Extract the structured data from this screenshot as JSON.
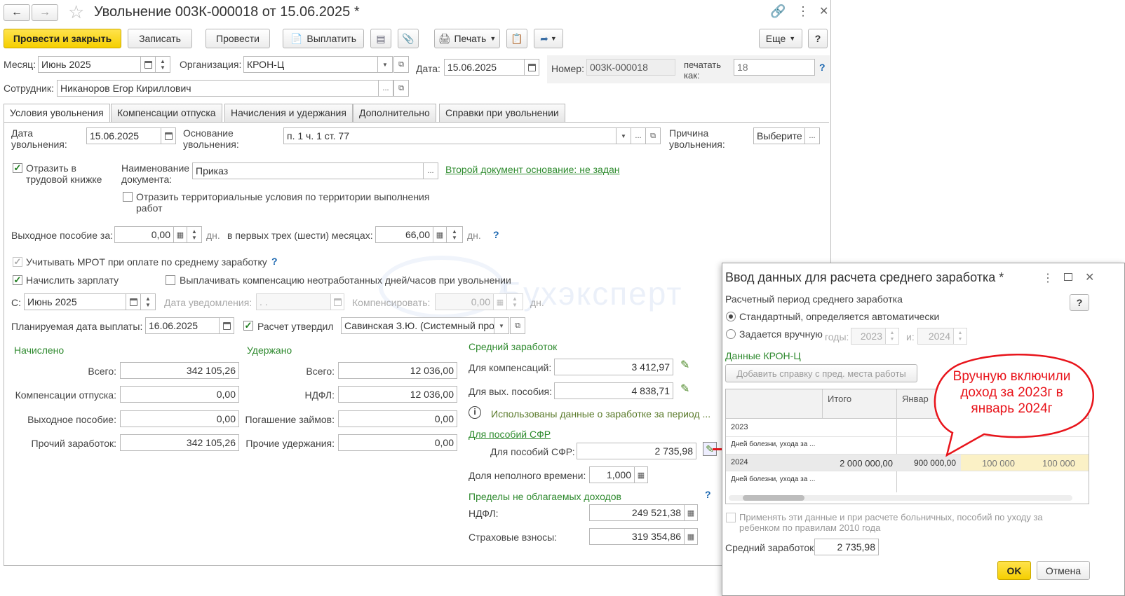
{
  "window": {
    "title": "Увольнение 003К-000018 от 15.06.2025 *"
  },
  "toolbar": {
    "post_close": "Провести и закрыть",
    "save": "Записать",
    "post": "Провести",
    "pay": "Выплатить",
    "print": "Печать",
    "more": "Еще",
    "help": "?"
  },
  "header": {
    "month_label": "Месяц:",
    "month_value": "Июнь 2025",
    "org_label": "Организация:",
    "org_value": "КРОН-Ц",
    "date_label": "Дата:",
    "date_value": "15.06.2025",
    "number_label": "Номер:",
    "number_value": "003К-000018",
    "print_as_label": "печатать как:",
    "print_as_placeholder": "18",
    "employee_label": "Сотрудник:",
    "employee_value": "Никаноров Егор Кириллович"
  },
  "tabs": [
    "Условия увольнения",
    "Компенсации отпуска",
    "Начисления и удержания",
    "Дополнительно",
    "Справки при увольнении"
  ],
  "conditions": {
    "dismissal_date_label": "Дата увольнения:",
    "dismissal_date": "15.06.2025",
    "basis_label": "Основание увольнения:",
    "basis_value": "п. 1 ч. 1 ст. 77",
    "reason_label": "Причина увольнения:",
    "reason_value": "Выберите",
    "reflect_book": "Отразить в трудовой книжке",
    "doc_name_label": "Наименование документа:",
    "doc_name_value": "Приказ",
    "second_doc_link": "Второй документ основание: не задан",
    "territorial": "Отразить территориальные условия по территории выполнения работ",
    "severance_label": "Выходное пособие за:",
    "severance_value": "0,00",
    "days": "дн.",
    "first_months_label": "в первых трех (шести) месяцах:",
    "first_months_value": "66,00",
    "mrot": "Учитывать МРОТ при оплате по среднему заработку",
    "accrue_salary": "Начислить зарплату",
    "pay_comp_unworked": "Выплачивать компенсацию неотработанных дней/часов при увольнении",
    "from_label": "С:",
    "from_value": "Июнь 2025",
    "notice_date_label": "Дата уведомления:",
    "notice_date_value": " .  .",
    "compensate_label": "Компенсировать:",
    "compensate_value": "0,00",
    "planned_pay_label": "Планируемая дата выплаты:",
    "planned_pay_value": "16.06.2025",
    "approved_label": "Расчет утвердил",
    "approved_value": "Савинская З.Ю. (Системный про"
  },
  "accrued": {
    "title": "Начислено",
    "rows": [
      {
        "label": "Всего:",
        "value": "342 105,26"
      },
      {
        "label": "Компенсации отпуска:",
        "value": "0,00"
      },
      {
        "label": "Выходное пособие:",
        "value": "0,00"
      },
      {
        "label": "Прочий заработок:",
        "value": "342 105,26"
      }
    ]
  },
  "withheld": {
    "title": "Удержано",
    "rows": [
      {
        "label": "Всего:",
        "value": "12 036,00"
      },
      {
        "label": "НДФЛ:",
        "value": "12 036,00"
      },
      {
        "label": "Погашение займов:",
        "value": "0,00"
      },
      {
        "label": "Прочие удержания:",
        "value": "0,00"
      }
    ]
  },
  "average": {
    "title": "Средний заработок",
    "comp_label": "Для компенсаций:",
    "comp_value": "3 412,97",
    "sev_label": "Для вых. пособия:",
    "sev_value": "4 838,71",
    "info_text": "Использованы данные о заработке за период ...",
    "sfr_link": "Для пособий СФР",
    "sfr_label": "Для пособий СФР:",
    "sfr_value": "2 735,98",
    "part_time_label": "Доля неполного времени:",
    "part_time_value": "1,000",
    "limits_title": "Пределы не облагаемых доходов",
    "ndfl_label": "НДФЛ:",
    "ndfl_value": "249 521,38",
    "ins_label": "Страховые взносы:",
    "ins_value": "319 354,86"
  },
  "watermark": "Бухэксперт",
  "dialog": {
    "title": "Ввод данных для расчета среднего заработка *",
    "period_label": "Расчетный период среднего заработка",
    "help": "?",
    "radio_standard": "Стандартный, определяется автоматически",
    "radio_manual": "Задается вручную",
    "years_label": "годы:",
    "year1": "2023",
    "and_label": "и:",
    "year2": "2024",
    "data_title": "Данные КРОН-Ц",
    "add_cert_button": "Добавить справку с пред. места работы",
    "grid_headers": [
      "",
      "Итого",
      "Январ"
    ],
    "grid_rows": [
      {
        "col0": "2023",
        "total": "",
        "jan": "",
        "extra": [
          "",
          ""
        ]
      },
      {
        "col0": "Дней болезни, ухода за ...",
        "total": "",
        "jan": "",
        "extra": [
          "",
          ""
        ]
      },
      {
        "col0": "2024",
        "total": "2 000 000,00",
        "jan": "900 000,00",
        "extra": [
          "100 000",
          "100 000"
        ]
      },
      {
        "col0": "Дней болезни, ухода за ...",
        "total": "",
        "jan": "",
        "extra": [
          "",
          ""
        ]
      }
    ],
    "apply_label": "Применять эти данные и при расчете больничных, пособий по уходу за ребенком по правилам 2010 года",
    "avg_label": "Средний заработок:",
    "avg_value": "2 735,98",
    "ok": "OK",
    "cancel": "Отмена"
  },
  "callout": {
    "text": "Вручную включили доход за 2023г в январь 2024г",
    "color": "#e8141b"
  }
}
